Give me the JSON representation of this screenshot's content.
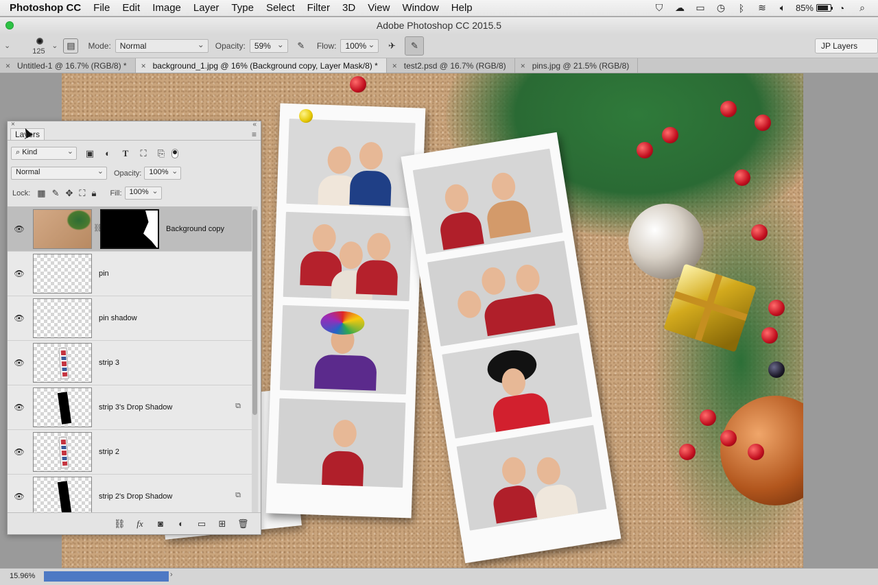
{
  "menubar": {
    "app": "Photoshop CC",
    "items": [
      "File",
      "Edit",
      "Image",
      "Layer",
      "Type",
      "Select",
      "Filter",
      "3D",
      "View",
      "Window",
      "Help"
    ],
    "status_icons": [
      "shield-icon",
      "cloud-icon",
      "airplay-icon",
      "time-machine-icon",
      "bluetooth-icon",
      "wifi-icon",
      "volume-icon"
    ],
    "battery": "85%",
    "battery_level": 0.85
  },
  "window": {
    "title": "Adobe Photoshop CC 2015.5"
  },
  "options": {
    "brush_size": "125",
    "mode_label": "Mode:",
    "mode_value": "Normal",
    "opacity_label": "Opacity:",
    "opacity_value": "59%",
    "flow_label": "Flow:",
    "flow_value": "100%",
    "workspace": "JP Layers"
  },
  "tabs": [
    {
      "label": "Untitled-1 @ 16.7% (RGB/8) *",
      "active": false
    },
    {
      "label": "background_1.jpg @ 16% (Background copy, Layer Mask/8) *",
      "active": true
    },
    {
      "label": "test2.psd @ 16.7% (RGB/8)",
      "active": false
    },
    {
      "label": "pins.jpg @ 21.5% (RGB/8)",
      "active": false
    }
  ],
  "layers_panel": {
    "tab": "Layers",
    "filter_kind": "Kind",
    "blend_mode": "Normal",
    "opacity_label": "Opacity:",
    "opacity_value": "100%",
    "lock_label": "Lock:",
    "fill_label": "Fill:",
    "fill_value": "100%",
    "layers": [
      {
        "name": "Background copy",
        "selected": true,
        "has_mask": true
      },
      {
        "name": "pin",
        "selected": false
      },
      {
        "name": "pin shadow",
        "selected": false
      },
      {
        "name": "strip 3",
        "selected": false
      },
      {
        "name": "strip 3's Drop Shadow",
        "selected": false,
        "linked_effect": true
      },
      {
        "name": "strip 2",
        "selected": false
      },
      {
        "name": "strip 2's Drop Shadow",
        "selected": false,
        "linked_effect": true
      }
    ]
  },
  "statusbar": {
    "zoom": "15.96%"
  },
  "colors": {
    "progress": "#4d79c4",
    "selected_layer": "#bdbdbd",
    "cork": "#c9a47c"
  }
}
